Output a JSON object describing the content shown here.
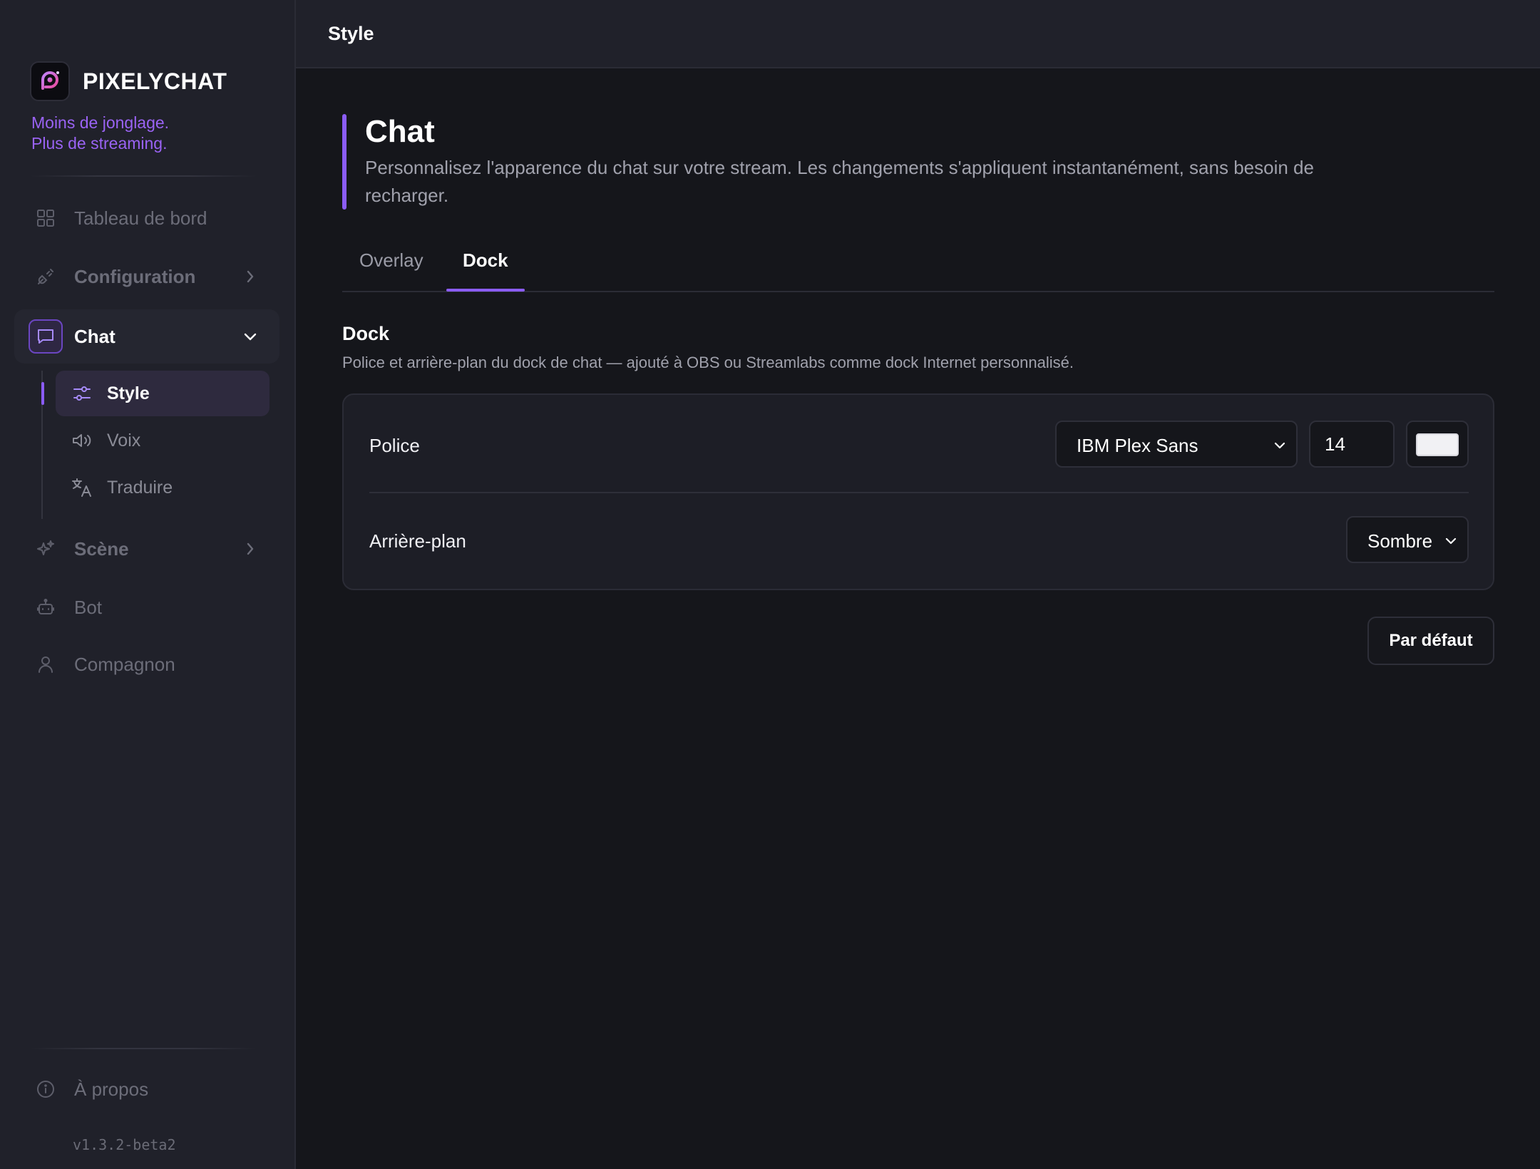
{
  "brand": {
    "name": "PIXELYCHAT",
    "tagline_line1": "Moins de jonglage.",
    "tagline_line2": "Plus de streaming.",
    "accent_color": "#8b5cf6"
  },
  "sidebar": {
    "items": [
      {
        "label": "Tableau de bord",
        "icon": "grid-icon"
      },
      {
        "label": "Configuration",
        "icon": "plug-icon",
        "expandable": true
      },
      {
        "label": "Chat",
        "icon": "chat-bubble-icon",
        "expanded": true,
        "active": true
      },
      {
        "label": "Scène",
        "icon": "sparkles-icon",
        "expandable": true
      },
      {
        "label": "Bot",
        "icon": "robot-icon"
      },
      {
        "label": "Compagnon",
        "icon": "user-icon"
      }
    ],
    "chat_subitems": [
      {
        "label": "Style",
        "icon": "sliders-icon",
        "active": true
      },
      {
        "label": "Voix",
        "icon": "speaker-icon"
      },
      {
        "label": "Traduire",
        "icon": "translate-icon"
      }
    ],
    "about_label": "À propos",
    "version": "v1.3.2-beta2"
  },
  "header": {
    "title": "Style"
  },
  "page": {
    "title": "Chat",
    "description": "Personnalisez l'apparence du chat sur votre stream. Les changements s'appliquent instantanément, sans besoin de recharger."
  },
  "tabs": [
    {
      "label": "Overlay",
      "active": false
    },
    {
      "label": "Dock",
      "active": true
    }
  ],
  "dock_section": {
    "title": "Dock",
    "description": "Police et arrière-plan du dock de chat — ajouté à OBS ou Streamlabs comme dock Internet personnalisé.",
    "font_row": {
      "label": "Police",
      "font_value": "IBM Plex Sans",
      "size_value": "14",
      "color_value": "#f1f1f4"
    },
    "background_row": {
      "label": "Arrière-plan",
      "value": "Sombre"
    }
  },
  "actions": {
    "reset_label": "Par défaut"
  }
}
